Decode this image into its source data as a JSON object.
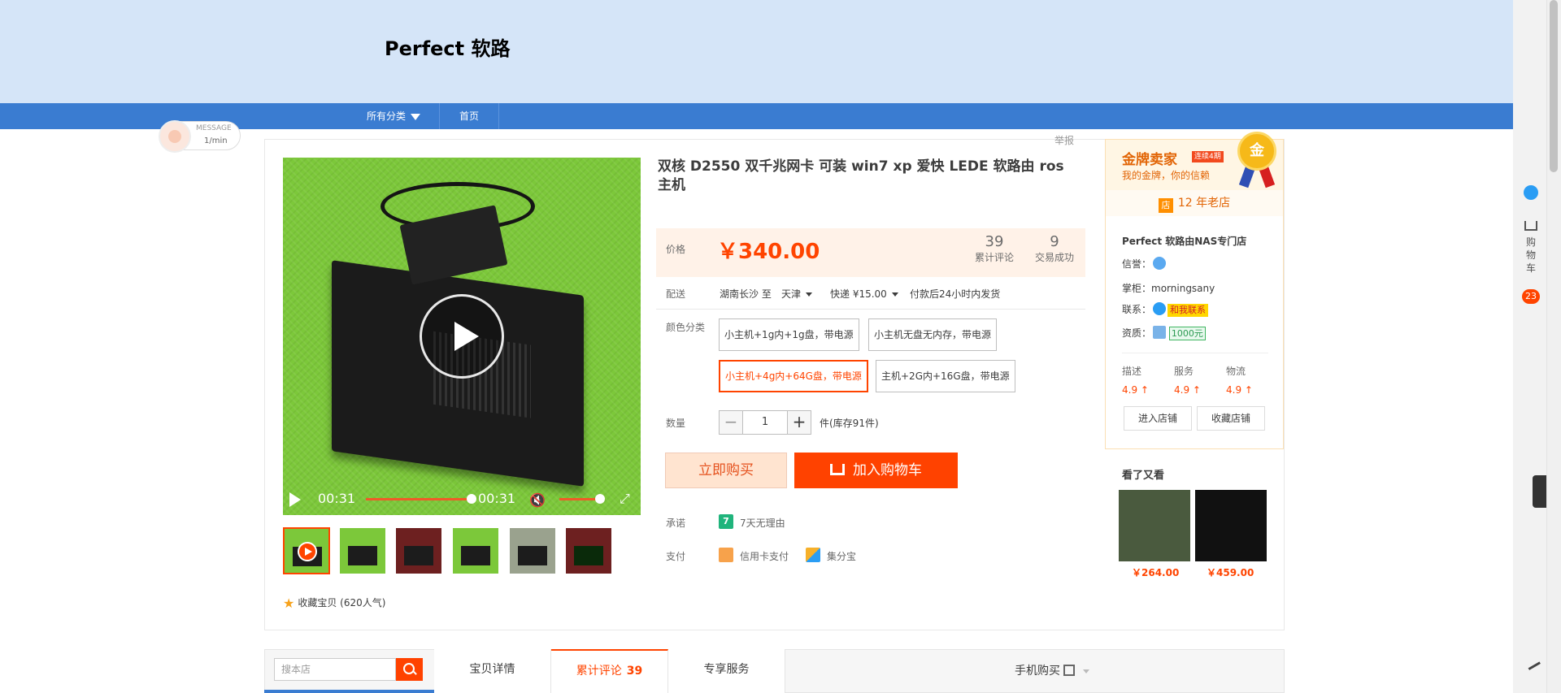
{
  "header": {
    "shop_title": "Perfect 软路"
  },
  "nav": {
    "all_categories": "所有分类",
    "home": "首页"
  },
  "message_badge": {
    "label": "MESSAGE",
    "rate": "1/min"
  },
  "report": "举报",
  "product": {
    "title": "双核 D2550 双千兆网卡 可装 win7 xp 爱快 LEDE 软路由 ros 主机",
    "price_label": "价格",
    "price": "￥340.00",
    "reviews_count": "39",
    "reviews_label": "累计评论",
    "deals_count": "9",
    "deals_label": "交易成功",
    "delivery_label": "配送",
    "delivery_from": "湖南长沙 至",
    "delivery_to": "天津",
    "shipping": "快递 ¥15.00",
    "ship_time": "付款后24小时内发货",
    "color_label": "颜色分类",
    "skus": [
      {
        "label": "小主机+1g内+1g盘，带电源",
        "selected": false
      },
      {
        "label": "小主机无盘无内存，带电源",
        "selected": false
      },
      {
        "label": "小主机+4g内+64G盘，带电源",
        "selected": true
      },
      {
        "label": "主机+2G内+16G盘，带电源",
        "selected": false
      }
    ],
    "qty_label": "数量",
    "qty_minus": "−",
    "qty_value": "1",
    "qty_plus": "+",
    "stock": "件(库存91件)",
    "buy_now": "立即购买",
    "add_cart": "加入购物车",
    "promise_label": "承诺",
    "promise_icon": "7",
    "promise_text": "7天无理由",
    "pay_label": "支付",
    "pay_card": "信用卡支付",
    "pay_jfb": "集分宝",
    "favorite": "收藏宝贝 (620人气)"
  },
  "video": {
    "time_current": "00:31",
    "time_total": "00:31",
    "progress": 1.0,
    "volume": 0.9
  },
  "seller": {
    "gold_title": "金牌卖家",
    "gold_tag": "连续4期",
    "gold_sub": "我的金牌，你的信赖",
    "medal": "金",
    "age_icon": "店",
    "age": "12 年老店",
    "shop_name": "Perfect 软路由NAS专门店",
    "credit_label": "信誉：",
    "owner_label": "掌柜：",
    "owner": "morningsany",
    "contact_label": "联系：",
    "contact_btn": "和我联系",
    "qual_label": "资质：",
    "deposit": "1000元",
    "scores": [
      {
        "label": "描述",
        "value": "4.9 ↑"
      },
      {
        "label": "服务",
        "value": "4.9 ↑"
      },
      {
        "label": "物流",
        "value": "4.9 ↑"
      }
    ],
    "enter_shop": "进入店铺",
    "fav_shop": "收藏店铺"
  },
  "seen": {
    "title": "看了又看",
    "items": [
      {
        "price": "￥264.00"
      },
      {
        "price": "￥459.00"
      }
    ]
  },
  "bottom": {
    "search_placeholder": "搜本店",
    "tab_detail": "宝贝详情",
    "tab_reviews": "累计评论",
    "tab_reviews_count": "39",
    "tab_service": "专享服务",
    "mobile_buy": "手机购买"
  },
  "right_bar": {
    "cart_label": "购物车",
    "cart_count": "23"
  },
  "colors": {
    "accent": "#ff4400",
    "nav_blue": "#3a7cd1",
    "header_bg": "#d5e5f8"
  }
}
